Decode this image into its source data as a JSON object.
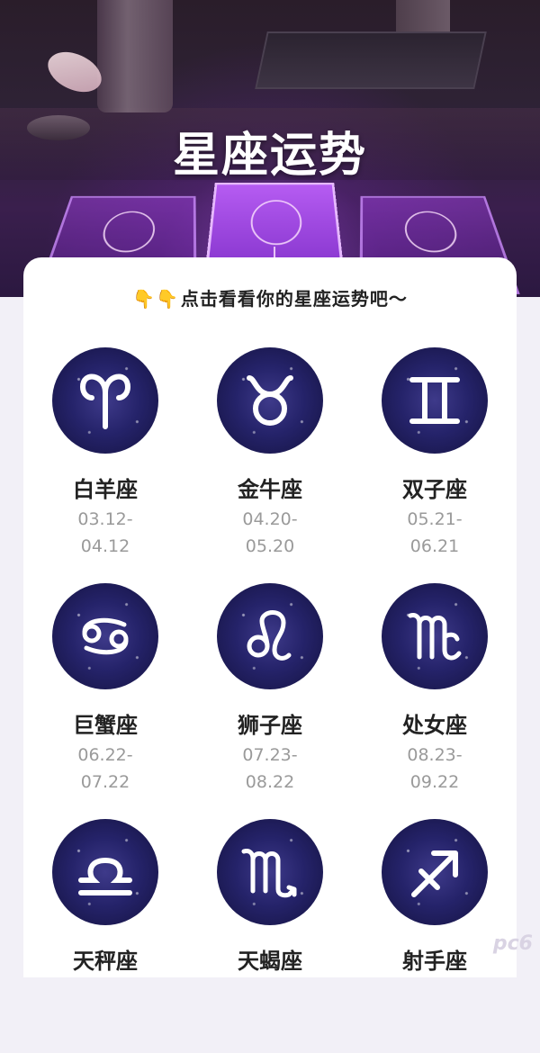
{
  "header": {
    "title": "星座运势"
  },
  "hint": {
    "hand_icons": "👇👇",
    "text": "点击看看你的星座运势吧～"
  },
  "signs": [
    {
      "name": "白羊座",
      "date_start": "03.12-",
      "date_end": "04.12",
      "icon": "aries-icon"
    },
    {
      "name": "金牛座",
      "date_start": "04.20-",
      "date_end": "05.20",
      "icon": "taurus-icon"
    },
    {
      "name": "双子座",
      "date_start": "05.21-",
      "date_end": "06.21",
      "icon": "gemini-icon"
    },
    {
      "name": "巨蟹座",
      "date_start": "06.22-",
      "date_end": "07.22",
      "icon": "cancer-icon"
    },
    {
      "name": "狮子座",
      "date_start": "07.23-",
      "date_end": "08.22",
      "icon": "leo-icon"
    },
    {
      "name": "处女座",
      "date_start": "08.23-",
      "date_end": "09.22",
      "icon": "virgo-icon"
    },
    {
      "name": "天秤座",
      "date_start": "",
      "date_end": "",
      "icon": "libra-icon"
    },
    {
      "name": "天蝎座",
      "date_start": "",
      "date_end": "",
      "icon": "scorpio-icon"
    },
    {
      "name": "射手座",
      "date_start": "",
      "date_end": "",
      "icon": "sagittarius-icon"
    }
  ],
  "watermark": "pc6",
  "colors": {
    "accent": "#f2b01e",
    "circle": "#25236a",
    "panel": "#ffffff"
  }
}
